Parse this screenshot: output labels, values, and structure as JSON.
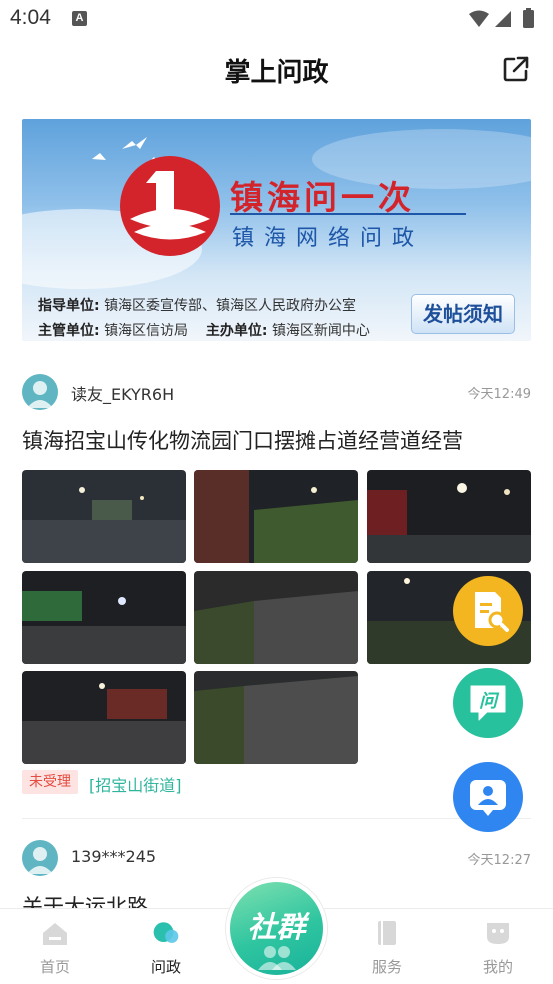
{
  "status_bar": {
    "time": "4:04",
    "notification_icon": "A"
  },
  "header": {
    "title": "掌上问政",
    "share_icon": "share-external-icon"
  },
  "banner": {
    "title": "镇海问一次",
    "subtitle": "镇海网络问政",
    "guide_label": "指导单位:",
    "guide_value": "镇海区委宣传部、镇海区人民政府办公室",
    "manager_label": "主管单位:",
    "manager_value": "镇海区信访局",
    "host_label": "主办单位:",
    "host_value": "镇海区新闻中心",
    "notice_button": "发帖须知",
    "colors": {
      "logo_red": "#d4242b",
      "text_blue": "#1e56a8"
    }
  },
  "posts": [
    {
      "username": "读友_EKYR6H",
      "time": "今天12:49",
      "title": "镇海招宝山传化物流园门口摆摊占道经营道经营",
      "photo_count": 8,
      "status": "未受理",
      "area": "[招宝山街道]"
    },
    {
      "username": "139***245",
      "time": "今天12:27",
      "title": "关于大运北路"
    }
  ],
  "floating_actions": [
    {
      "name": "search-document-icon",
      "color": "#f3b620"
    },
    {
      "name": "ask-question-icon",
      "color": "#27c19d"
    },
    {
      "name": "contact-card-icon",
      "color": "#2f86f0"
    }
  ],
  "tabbar": {
    "tabs": [
      {
        "label": "首页",
        "icon": "home-icon",
        "active": false
      },
      {
        "label": "问政",
        "icon": "chat-bubble-icon",
        "active": true
      },
      {
        "label": "服务",
        "icon": "book-icon",
        "active": false
      },
      {
        "label": "我的",
        "icon": "profile-icon",
        "active": false
      }
    ],
    "center_label": "社群",
    "center_color": "#2fc5a0"
  }
}
